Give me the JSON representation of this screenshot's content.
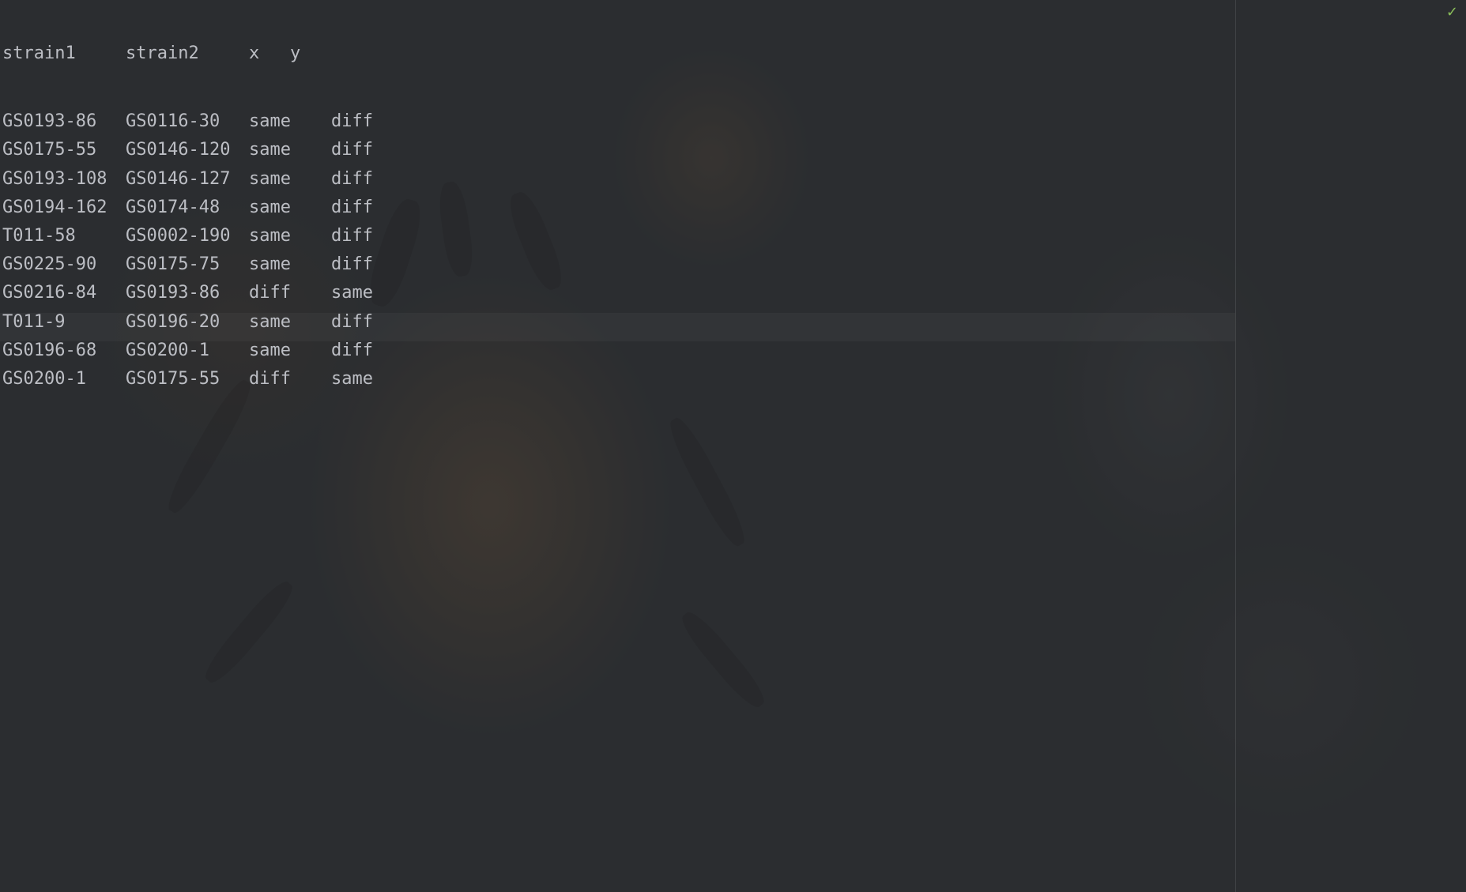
{
  "editor": {
    "header": [
      "strain1",
      "strain2",
      "x",
      "y"
    ],
    "rows": [
      [
        "GS0193-86",
        "GS0116-30",
        "same",
        "diff"
      ],
      [
        "GS0175-55",
        "GS0146-120",
        "same",
        "diff"
      ],
      [
        "GS0193-108",
        "GS0146-127",
        "same",
        "diff"
      ],
      [
        "GS0194-162",
        "GS0174-48",
        "same",
        "diff"
      ],
      [
        "T011-58",
        "GS0002-190",
        "same",
        "diff"
      ],
      [
        "GS0225-90",
        "GS0175-75",
        "same",
        "diff"
      ],
      [
        "GS0216-84",
        "GS0193-86",
        "diff",
        "same"
      ],
      [
        "T011-9",
        "GS0196-20",
        "same",
        "diff"
      ],
      [
        "GS0196-68",
        "GS0200-1",
        "same",
        "diff"
      ],
      [
        "GS0200-1",
        "GS0175-55",
        "diff",
        "same"
      ]
    ],
    "text_color": "#bcbec4",
    "background_color": "#2b2d30"
  },
  "status": {
    "inspection_icon": "check-icon",
    "inspection_glyph": "✓",
    "inspection_color": "#8bbf5a"
  }
}
